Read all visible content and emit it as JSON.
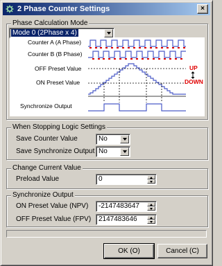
{
  "window": {
    "title": "2 Phase Counter Settings",
    "close_glyph": "×"
  },
  "calc_mode": {
    "group_label": "Phase Calculation Mode",
    "selected": "Mode 0 (2Phase x 4)",
    "diagram": {
      "labels": [
        "Counter A (A Phase)",
        "Counter B (B Phase)",
        "OFF Preset Value",
        "ON Preset Value",
        "Synchronize Output"
      ],
      "up_label": "UP",
      "down_label": "DOWN"
    }
  },
  "stopping": {
    "group_label": "When Stopping Logic Settings",
    "save_counter_label": "Save Counter Value",
    "save_counter_value": "No",
    "save_sync_label": "Save Synchronize Output",
    "save_sync_value": "No"
  },
  "change_value": {
    "group_label": "Change Current Value",
    "preload_label": "Preload Value",
    "preload_value": "0"
  },
  "sync_output": {
    "group_label": "Synchronize Output",
    "npv_label": "ON Preset Value (NPV)",
    "npv_value": "-2147483647",
    "fpv_label": "OFF Preset Value (FPV)",
    "fpv_value": "2147483646"
  },
  "buttons": {
    "ok": "OK (O)",
    "cancel": "Cancel (C)"
  },
  "colors": {
    "title_start": "#0a246a",
    "title_end": "#a6caf0",
    "signal": "#4b5bc8",
    "marker": "#e00000",
    "face": "#d4d0c8"
  }
}
